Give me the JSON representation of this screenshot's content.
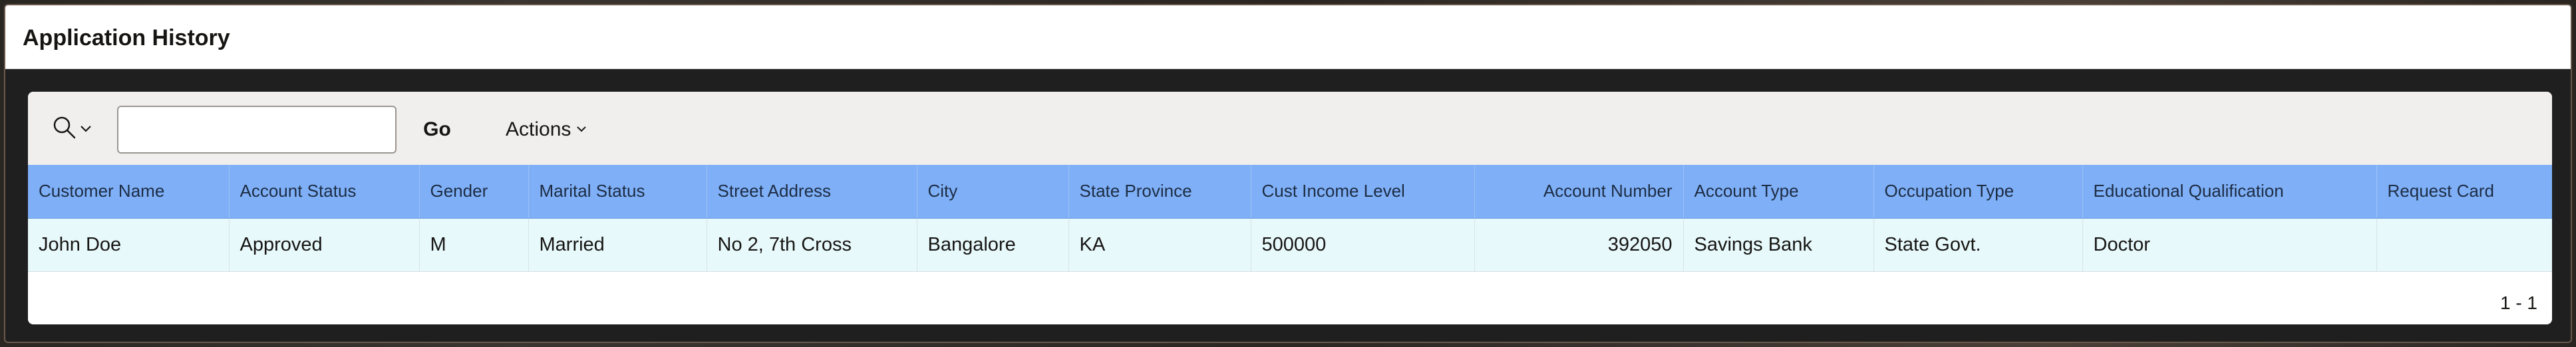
{
  "region": {
    "title": "Application History"
  },
  "toolbar": {
    "search_icon": "search-icon",
    "search_value": "",
    "go_label": "Go",
    "actions_label": "Actions"
  },
  "table": {
    "columns": [
      {
        "key": "customer_name",
        "label": "Customer Name",
        "align": "left"
      },
      {
        "key": "account_status",
        "label": "Account Status",
        "align": "left"
      },
      {
        "key": "gender",
        "label": "Gender",
        "align": "left"
      },
      {
        "key": "marital_status",
        "label": "Marital Status",
        "align": "left"
      },
      {
        "key": "street_address",
        "label": "Street Address",
        "align": "left"
      },
      {
        "key": "city",
        "label": "City",
        "align": "left"
      },
      {
        "key": "state_province",
        "label": "State Province",
        "align": "left"
      },
      {
        "key": "cust_income_level",
        "label": "Cust Income Level",
        "align": "left"
      },
      {
        "key": "account_number",
        "label": "Account Number",
        "align": "right"
      },
      {
        "key": "account_type",
        "label": "Account Type",
        "align": "left"
      },
      {
        "key": "occupation_type",
        "label": "Occupation Type",
        "align": "left"
      },
      {
        "key": "educational_qualification",
        "label": "Educational Qualification",
        "align": "left"
      },
      {
        "key": "request_card",
        "label": "Request Card",
        "align": "left"
      }
    ],
    "rows": [
      [
        "John Doe",
        "Approved",
        "M",
        "Married",
        "No 2, 7th Cross",
        "Bangalore",
        "KA",
        "500000",
        "392050",
        "Savings Bank",
        "State Govt.",
        "Doctor",
        ""
      ]
    ]
  },
  "pagination": {
    "label": "1 - 1"
  },
  "colors": {
    "header_bg": "#7fb0f7",
    "row_bg": "#e8f9fb",
    "toolbar_bg": "#f1efed"
  }
}
